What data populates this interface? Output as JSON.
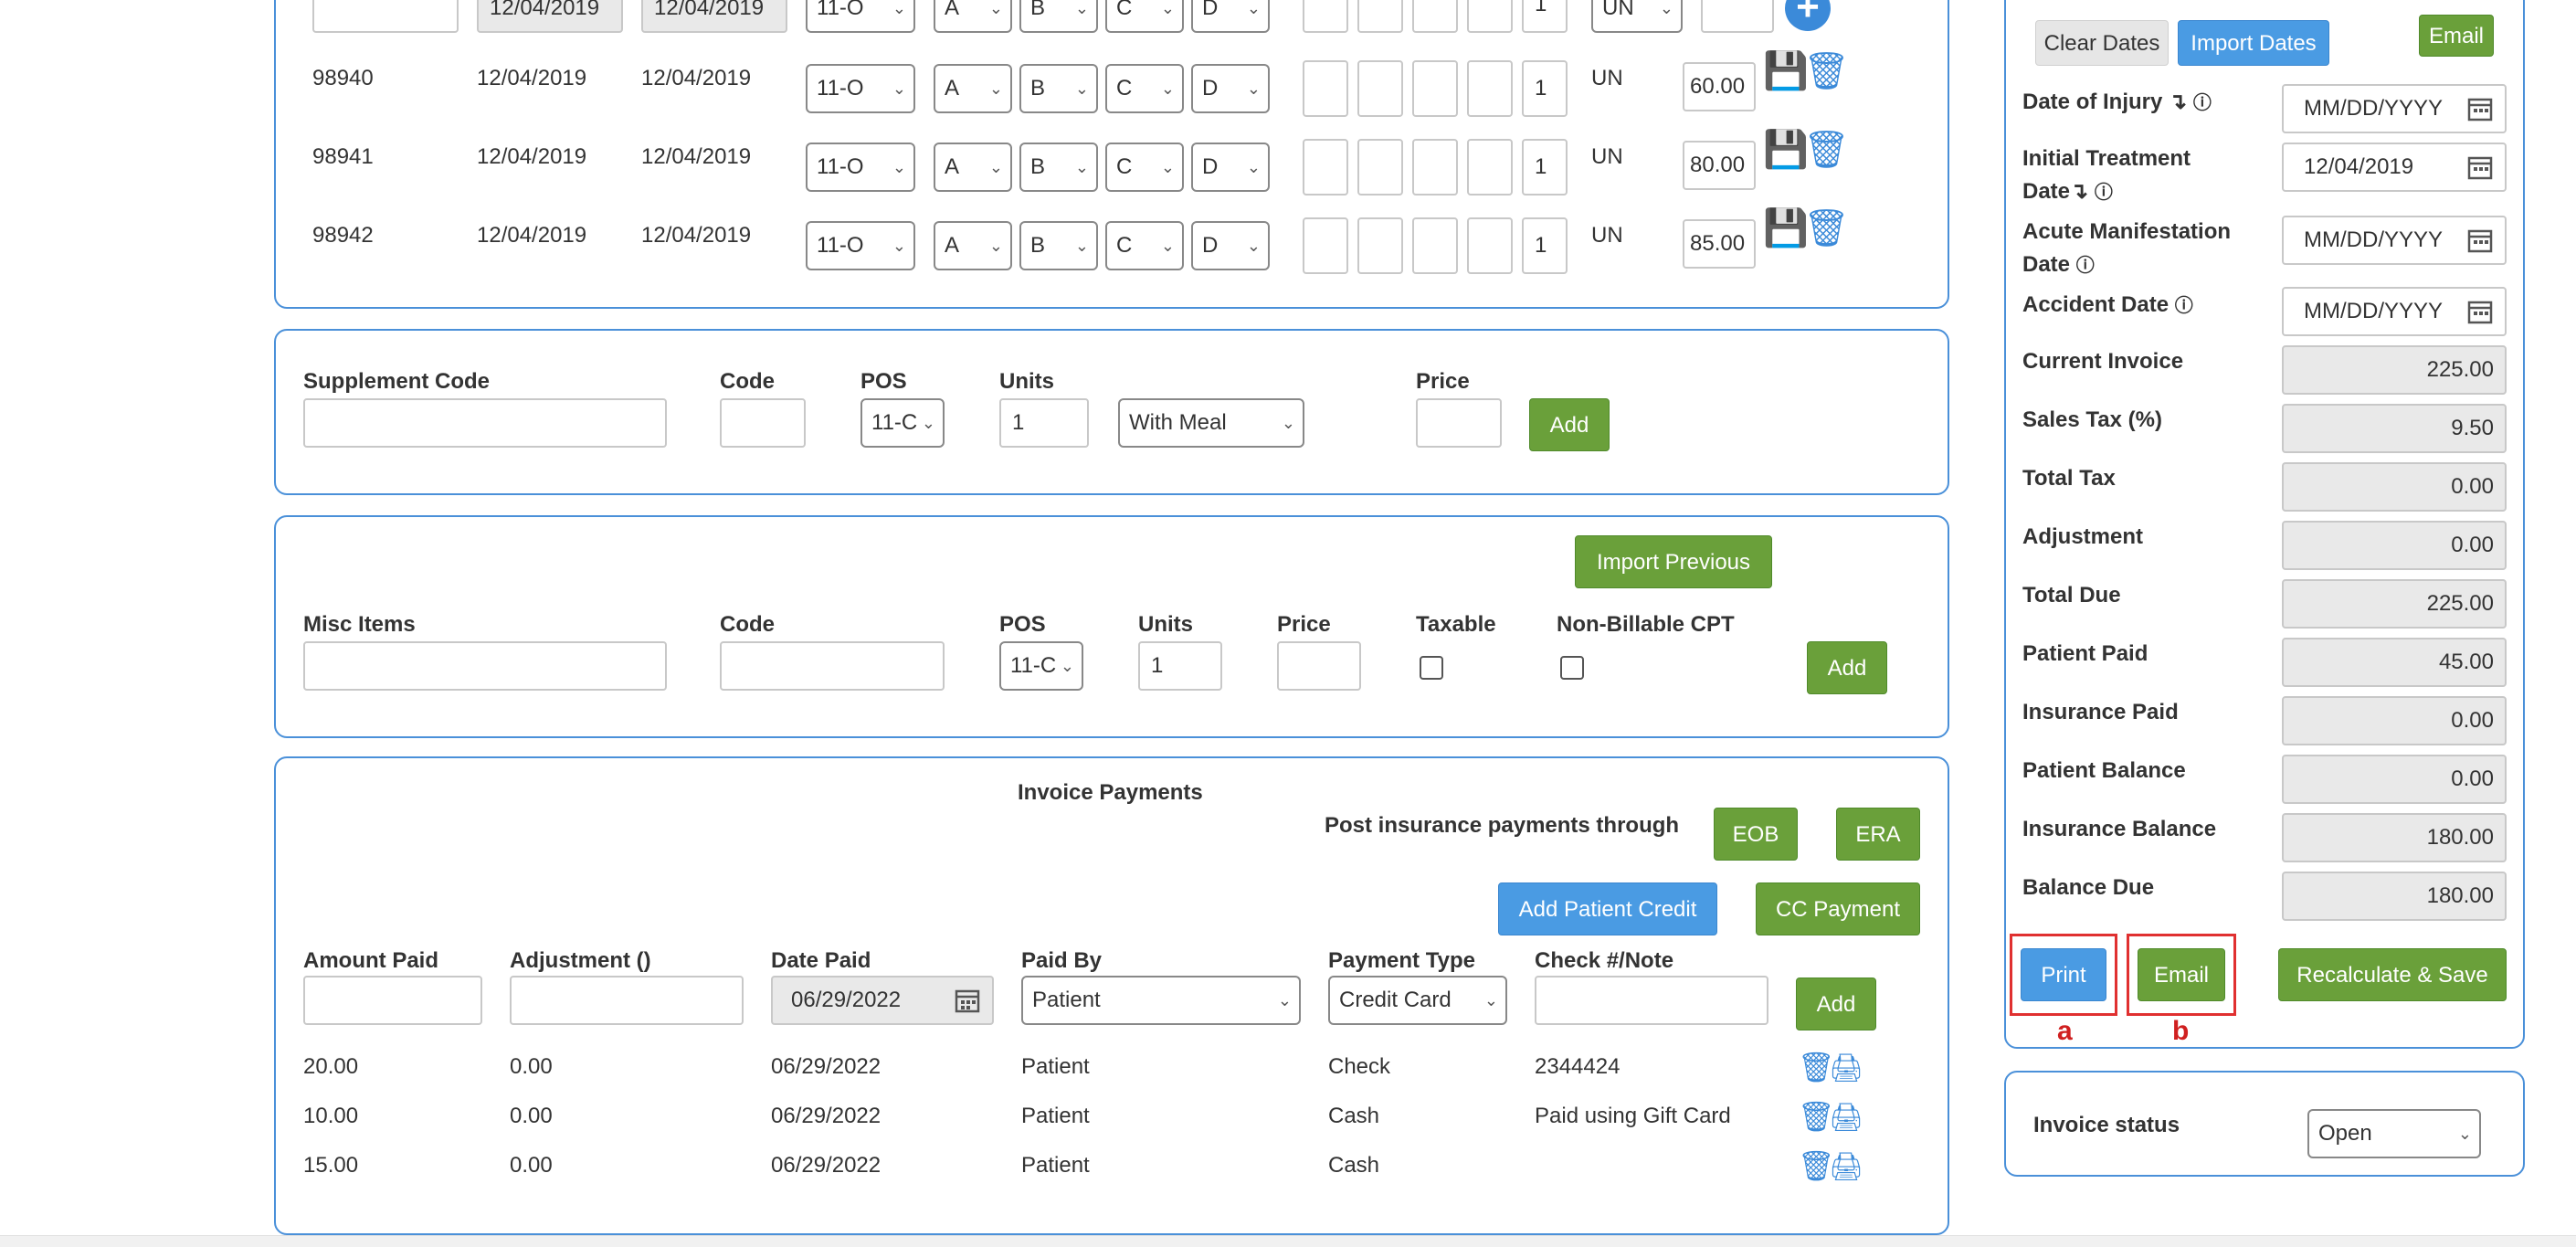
{
  "service_rows": {
    "top_row": {
      "date_from": "12/04/2019",
      "date_to": "12/04/2019",
      "pos": "11-O",
      "m1": "A",
      "m2": "B",
      "m3": "C",
      "m4": "D",
      "units": "1",
      "unit_type": "UN"
    },
    "rows": [
      {
        "code": "98940",
        "date_from": "12/04/2019",
        "date_to": "12/04/2019",
        "pos": "11-O",
        "m1": "A",
        "m2": "B",
        "m3": "C",
        "m4": "D",
        "units": "1",
        "unit_type": "UN",
        "price": "60.00"
      },
      {
        "code": "98941",
        "date_from": "12/04/2019",
        "date_to": "12/04/2019",
        "pos": "11-O",
        "m1": "A",
        "m2": "B",
        "m3": "C",
        "m4": "D",
        "units": "1",
        "unit_type": "UN",
        "price": "80.00"
      },
      {
        "code": "98942",
        "date_from": "12/04/2019",
        "date_to": "12/04/2019",
        "pos": "11-O",
        "m1": "A",
        "m2": "B",
        "m3": "C",
        "m4": "D",
        "units": "1",
        "unit_type": "UN",
        "price": "85.00"
      }
    ]
  },
  "supplement": {
    "label": "Supplement Code",
    "code_label": "Code",
    "pos_label": "POS",
    "units_label": "Units",
    "price_label": "Price",
    "pos_value": "11-C",
    "units_value": "1",
    "meal_value": "With Meal",
    "add_label": "Add"
  },
  "misc": {
    "import_label": "Import Previous",
    "label": "Misc Items",
    "code_label": "Code",
    "pos_label": "POS",
    "units_label": "Units",
    "price_label": "Price",
    "taxable_label": "Taxable",
    "nonbill_label": "Non-Billable CPT",
    "pos_value": "11-C",
    "units_value": "1",
    "add_label": "Add"
  },
  "payments": {
    "title": "Invoice Payments",
    "post_label": "Post insurance payments through",
    "eob_label": "EOB",
    "era_label": "ERA",
    "add_credit_label": "Add Patient Credit",
    "cc_label": "CC Payment",
    "headers": {
      "amount": "Amount Paid",
      "adjustment": "Adjustment ()",
      "date": "Date Paid",
      "paid_by": "Paid By",
      "type": "Payment Type",
      "check": "Check #/Note"
    },
    "date_value": "06/29/2022",
    "paid_by_value": "Patient",
    "type_value": "Credit Card",
    "add_label": "Add",
    "rows": [
      {
        "amount": "20.00",
        "adjustment": "0.00",
        "date": "06/29/2022",
        "paid_by": "Patient",
        "type": "Check",
        "note": "2344424"
      },
      {
        "amount": "10.00",
        "adjustment": "0.00",
        "date": "06/29/2022",
        "paid_by": "Patient",
        "type": "Cash",
        "note": "Paid using Gift Card"
      },
      {
        "amount": "15.00",
        "adjustment": "0.00",
        "date": "06/29/2022",
        "paid_by": "Patient",
        "type": "Cash",
        "note": ""
      }
    ]
  },
  "sidebar": {
    "clear_dates": "Clear Dates",
    "import_dates": "Import Dates",
    "email_top": "Email",
    "date_of_injury": "Date of Injury",
    "initial_treatment_1": "Initial Treatment",
    "initial_treatment_2": "Date",
    "acute_1": "Acute Manifestation",
    "acute_2": "Date",
    "accident": "Accident Date",
    "doi_value": "MM/DD/YYYY",
    "itd_value": "12/04/2019",
    "amd_value": "MM/DD/YYYY",
    "acc_value": "MM/DD/YYYY",
    "totals": [
      {
        "label": "Current Invoice",
        "value": "225.00"
      },
      {
        "label": "Sales Tax (%)",
        "value": "9.50"
      },
      {
        "label": "Total Tax",
        "value": "0.00"
      },
      {
        "label": "Adjustment",
        "value": "0.00"
      },
      {
        "label": "Total Due",
        "value": "225.00"
      },
      {
        "label": "Patient Paid",
        "value": "45.00"
      },
      {
        "label": "Insurance Paid",
        "value": "0.00"
      },
      {
        "label": "Patient Balance",
        "value": "0.00"
      },
      {
        "label": "Insurance Balance",
        "value": "180.00"
      },
      {
        "label": "Balance Due",
        "value": "180.00"
      }
    ],
    "print_label": "Print",
    "email_label": "Email",
    "recalc_label": "Recalculate & Save",
    "annot_a": "a",
    "annot_b": "b",
    "status_label": "Invoice status",
    "status_value": "Open"
  }
}
